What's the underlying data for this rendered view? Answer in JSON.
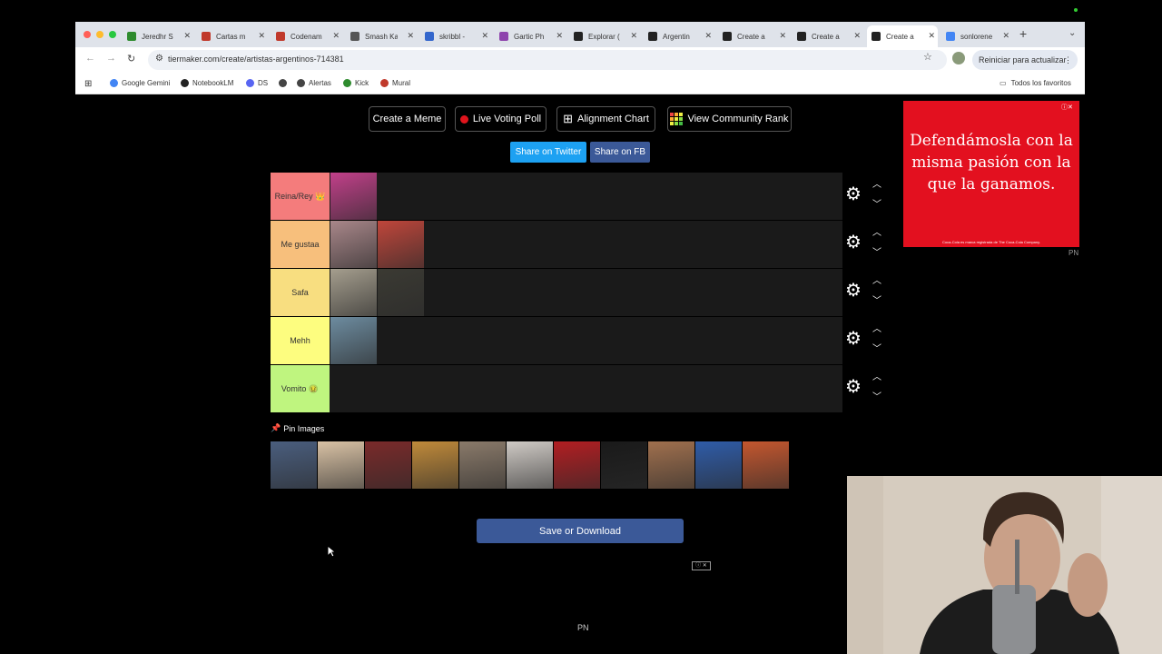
{
  "browser": {
    "tabs": [
      {
        "label": "Jeredhr S",
        "color": "#2e8b2e"
      },
      {
        "label": "Cartas m",
        "color": "#c0392b"
      },
      {
        "label": "Codenam",
        "color": "#c0392b"
      },
      {
        "label": "Smash Ka",
        "color": "#555555"
      },
      {
        "label": "skribbl - ",
        "color": "#3366cc"
      },
      {
        "label": "Gartic Ph",
        "color": "#8e44ad"
      },
      {
        "label": "Explorar (",
        "color": "#222222"
      },
      {
        "label": "Argentin",
        "color": "#222222"
      },
      {
        "label": "Create a ",
        "color": "#222222"
      },
      {
        "label": "Create a ",
        "color": "#222222"
      },
      {
        "label": "Create a",
        "color": "#222222",
        "active": true
      },
      {
        "label": "sonlorene",
        "color": "#4285f4"
      }
    ],
    "url": "tiermaker.com/create/artistas-argentinos-714381",
    "update_button": "Reiniciar para actualizar",
    "bookmarks": [
      {
        "label": "Google Gemini",
        "color": "#4285f4"
      },
      {
        "label": "NotebookLM",
        "color": "#222222"
      },
      {
        "label": "DS",
        "color": "#5865f2"
      },
      {
        "label": "",
        "color": "#444444"
      },
      {
        "label": "Alertas",
        "color": "#444444"
      },
      {
        "label": "Kick",
        "color": "#2e8b2e"
      },
      {
        "label": "Mural",
        "color": "#c0392b"
      }
    ],
    "favorites_label": "Todos los favoritos"
  },
  "page": {
    "actions": {
      "create_meme": "Create a Meme",
      "live_voting": "Live Voting Poll",
      "alignment_chart": "Alignment Chart",
      "community_rank": "View Community Rank"
    },
    "share": {
      "twitter": "Share on Twitter",
      "facebook": "Share on FB"
    },
    "tiers": [
      {
        "label": "Reina/Rey 👑",
        "color": "#f47c7c",
        "item_colors": [
          "#c2408a"
        ]
      },
      {
        "label": "Me gustaa",
        "color": "#f7bf7c",
        "item_colors": [
          "#a9878a",
          "#c0463b"
        ]
      },
      {
        "label": "Safa",
        "color": "#f8de80",
        "item_colors": [
          "#a59e8e",
          "#3b3a33"
        ]
      },
      {
        "label": "Mehh",
        "color": "#fdfd7f",
        "item_colors": [
          "#6d8ca0"
        ]
      },
      {
        "label": "Vomito 🤢",
        "color": "#bff57f",
        "item_colors": []
      }
    ],
    "pin_label": "Pin Images",
    "pool_colors": [
      "#4a5e7e",
      "#d9c2a5",
      "#7a2a2a",
      "#c08a3a",
      "#8a7a6a",
      "#cfcac5",
      "#b21e22",
      "#1a1a1a",
      "#a0704e",
      "#2f5ca8",
      "#c4572f"
    ],
    "save_button": "Save or Download",
    "ad_tag": "ⓘ ✕",
    "bottom_label": "PN"
  },
  "ad": {
    "text": "Defendámosla con la misma pasión con la que la ganamos.",
    "fineprint": "Coca-Cola es marca registrada de The Coca-Cola Company.",
    "badge": "PN",
    "corner": "ⓘ✕"
  }
}
